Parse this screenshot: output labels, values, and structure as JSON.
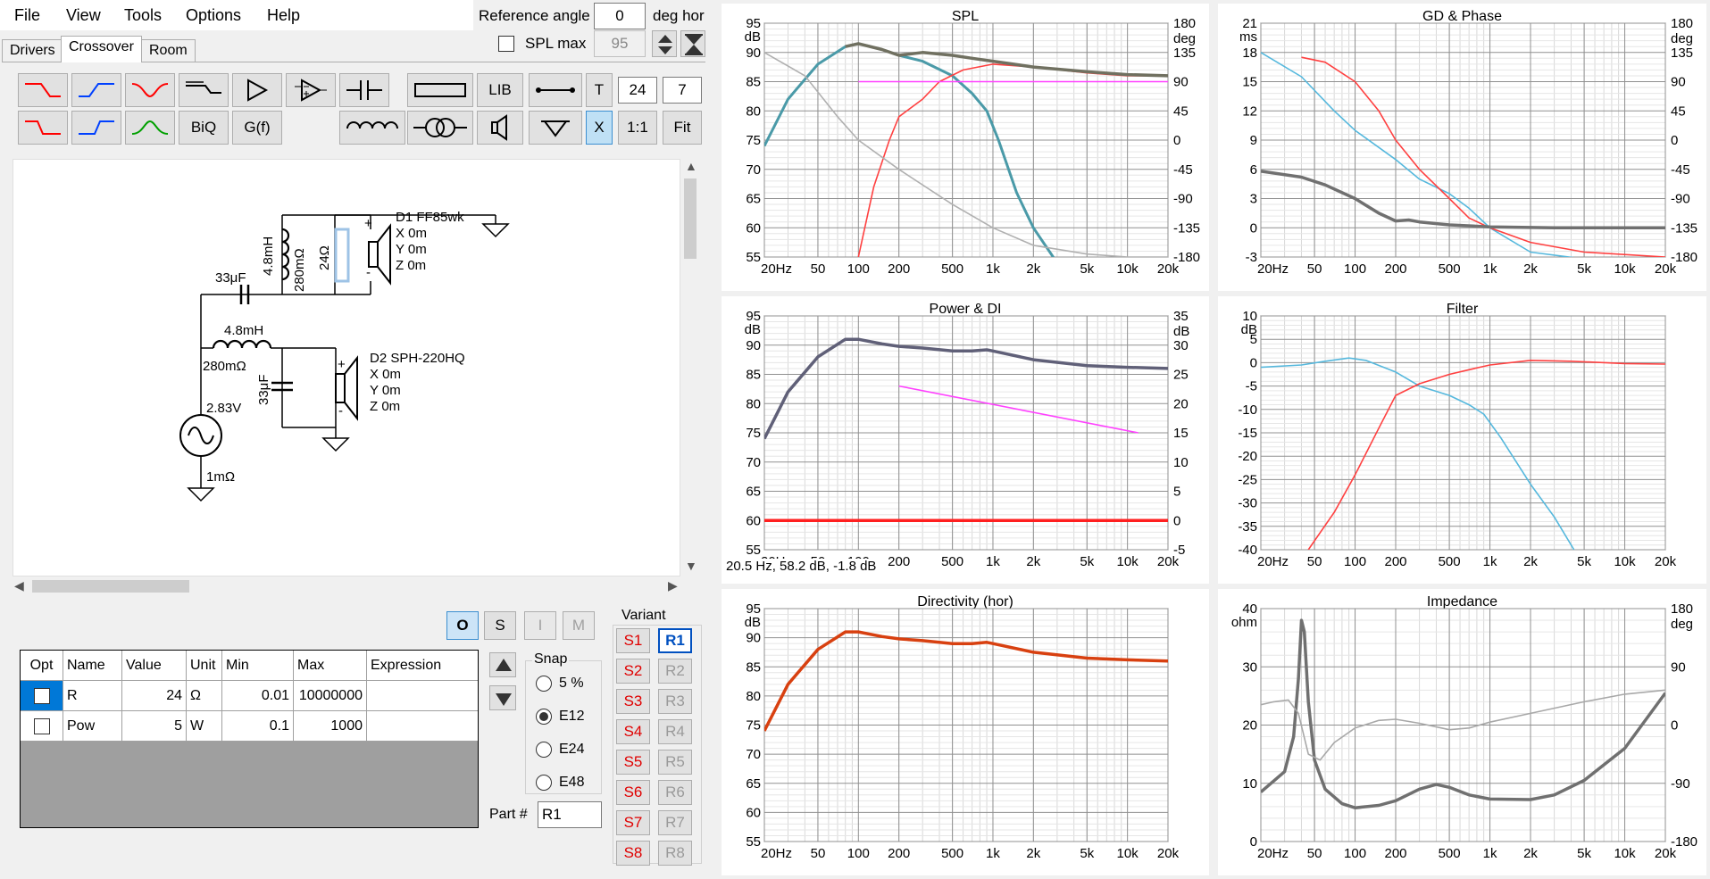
{
  "menu": {
    "file": "File",
    "view": "View",
    "tools": "Tools",
    "options": "Options",
    "help": "Help"
  },
  "header": {
    "reference_angle_label": "Reference angle",
    "reference_angle_value": "0",
    "deg_hor": "deg hor",
    "spl_max_label": "SPL max",
    "spl_max_value": "95"
  },
  "tabs": {
    "drivers": "Drivers",
    "crossover": "Crossover",
    "room": "Room"
  },
  "toolbar": {
    "lib": "LIB",
    "t": "T",
    "order": "24",
    "slope": "7",
    "biq": "BiQ",
    "gf": "G(f)",
    "x": "X",
    "one_to_one": "1:1",
    "fit": "Fit"
  },
  "colors": {
    "accent_red": "#ff0000",
    "accent_blue": "#0040ff",
    "accent_green": "#00a000",
    "selected_button": "#bfe0f5"
  },
  "schematic": {
    "d1_name": "D1 FF85wk",
    "d1_x": "X 0m",
    "d1_y": "Y 0m",
    "d1_z": "Z 0m",
    "d2_name": "D2 SPH-220HQ",
    "d2_x": "X 0m",
    "d2_y": "Y 0m",
    "d2_z": "Z 0m",
    "l1_value": "4.8mH",
    "l1_res": "280mΩ",
    "r1_value": "24Ω",
    "c1_value": "33μF",
    "l2_value": "4.8mH",
    "l2_res": "280mΩ",
    "c2_value": "33μF",
    "source_voltage": "2.83V",
    "source_res": "1mΩ",
    "plus": "+",
    "minus": "-"
  },
  "buttons": {
    "o": "O",
    "s": "S",
    "i": "I",
    "m": "M"
  },
  "table": {
    "headers": [
      "Opt",
      "Name",
      "Value",
      "Unit",
      "Min",
      "Max",
      "Expression"
    ],
    "rows": [
      [
        "",
        "R",
        "24",
        "Ω",
        "0.01",
        "10000000",
        ""
      ],
      [
        "",
        "Pow",
        "5",
        "W",
        "0.1",
        "1000",
        ""
      ]
    ]
  },
  "snap": {
    "label": "Snap",
    "options": [
      "5 %",
      "E12",
      "E24",
      "E48"
    ],
    "selected": "E12"
  },
  "part": {
    "label": "Part #",
    "value": "R1"
  },
  "variant": {
    "label": "Variant",
    "s": [
      "S1",
      "S2",
      "S3",
      "S4",
      "S5",
      "S6",
      "S7",
      "S8"
    ],
    "r": [
      "R1",
      "R2",
      "R3",
      "R4",
      "R5",
      "R6",
      "R7",
      "R8"
    ]
  },
  "charts": {
    "spl": {
      "title": "SPL",
      "yunit": "dB",
      "yunit2": "deg",
      "y_ticks": [
        "95",
        "90",
        "85",
        "80",
        "75",
        "70",
        "65",
        "60",
        "55"
      ],
      "y2_ticks": [
        "180",
        "135",
        "90",
        "45",
        "0",
        "-45",
        "-90",
        "-135",
        "-180"
      ]
    },
    "gd": {
      "title": "GD & Phase",
      "yunit": "ms",
      "yunit2": "deg",
      "y_ticks": [
        "21",
        "18",
        "15",
        "12",
        "9",
        "6",
        "3",
        "0",
        "-3"
      ],
      "y2_ticks": [
        "180",
        "135",
        "90",
        "45",
        "0",
        "-45",
        "-90",
        "-135",
        "-180"
      ]
    },
    "power": {
      "title": "Power & DI",
      "yunit": "dB",
      "yunit2": "dB",
      "y_ticks": [
        "95",
        "90",
        "85",
        "80",
        "75",
        "70",
        "65",
        "60",
        "55"
      ],
      "y2_ticks": [
        "35",
        "30",
        "25",
        "20",
        "15",
        "10",
        "5",
        "0",
        "-5"
      ],
      "readout": "20.5 Hz, 58.2 dB, -1.8 dB"
    },
    "filter": {
      "title": "Filter",
      "yunit": "dB",
      "y_ticks": [
        "10",
        "5",
        "0",
        "-5",
        "-10",
        "-15",
        "-20",
        "-25",
        "-30",
        "-35",
        "-40"
      ]
    },
    "dir": {
      "title": "Directivity (hor)",
      "yunit": "dB",
      "y_ticks": [
        "95",
        "90",
        "85",
        "80",
        "75",
        "70",
        "65",
        "60",
        "55"
      ]
    },
    "imp": {
      "title": "Impedance",
      "yunit": "ohm",
      "yunit2": "deg",
      "y_ticks": [
        "40",
        "30",
        "20",
        "10",
        "0"
      ],
      "y2_ticks": [
        "180",
        "90",
        "0",
        "-90",
        "-180"
      ]
    },
    "x_ticks": [
      "20Hz",
      "50",
      "100",
      "200",
      "500",
      "1k",
      "2k",
      "5k",
      "10k",
      "20k"
    ]
  },
  "chart_data": [
    {
      "type": "line",
      "title": "SPL",
      "x_scale": "log",
      "xlim": [
        20,
        20000
      ],
      "ylim": [
        55,
        95
      ],
      "y2lim": [
        -180,
        180
      ],
      "series": [
        {
          "color": "#4a9aa8",
          "points": [
            [
              20,
              74
            ],
            [
              30,
              82
            ],
            [
              50,
              88
            ],
            [
              80,
              91
            ],
            [
              100,
              91.5
            ],
            [
              150,
              90.5
            ],
            [
              200,
              89.5
            ],
            [
              300,
              88.5
            ],
            [
              500,
              86
            ],
            [
              700,
              83
            ],
            [
              900,
              80
            ],
            [
              1100,
              75
            ],
            [
              1500,
              66
            ],
            [
              2000,
              60
            ],
            [
              3000,
              54
            ]
          ]
        },
        {
          "color": "#ff4040",
          "points": [
            [
              100,
              55
            ],
            [
              130,
              67
            ],
            [
              170,
              75
            ],
            [
              200,
              79
            ],
            [
              300,
              82
            ],
            [
              400,
              85
            ],
            [
              600,
              87
            ],
            [
              1000,
              88
            ],
            [
              2000,
              87.5
            ],
            [
              5000,
              86.5
            ],
            [
              10000,
              86
            ],
            [
              20000,
              86
            ]
          ]
        },
        {
          "color": "#707060",
          "points": [
            [
              80,
              91
            ],
            [
              100,
              91.5
            ],
            [
              150,
              90.5
            ],
            [
              200,
              89.5
            ],
            [
              300,
              90
            ],
            [
              500,
              89.5
            ],
            [
              700,
              89
            ],
            [
              1000,
              88.5
            ],
            [
              2000,
              87.5
            ],
            [
              5000,
              86.7
            ],
            [
              10000,
              86.2
            ],
            [
              20000,
              86
            ]
          ]
        },
        {
          "color": "#ff40ff",
          "points": [
            [
              100,
              85
            ],
            [
              1000,
              85
            ],
            [
              20000,
              85
            ]
          ]
        },
        {
          "color": "#b0b0b0",
          "points": [
            [
              20,
              90
            ],
            [
              40,
              86
            ],
            [
              70,
              79
            ],
            [
              100,
              75
            ],
            [
              200,
              70
            ],
            [
              500,
              64
            ],
            [
              1000,
              60
            ],
            [
              2000,
              57
            ],
            [
              5000,
              55.5
            ],
            [
              10000,
              55
            ],
            [
              20000,
              55
            ]
          ]
        }
      ]
    },
    {
      "type": "line",
      "title": "GD & Phase",
      "x_scale": "log",
      "xlim": [
        20,
        20000
      ],
      "ylim": [
        -3,
        21
      ],
      "series": [
        {
          "color": "#55b8dd",
          "points": [
            [
              20,
              18
            ],
            [
              40,
              15.5
            ],
            [
              70,
              12
            ],
            [
              100,
              10
            ],
            [
              200,
              7
            ],
            [
              300,
              5
            ],
            [
              500,
              3.5
            ],
            [
              700,
              2
            ],
            [
              1000,
              0
            ],
            [
              2000,
              -2.5
            ],
            [
              5000,
              -3.2
            ],
            [
              20000,
              -3.2
            ]
          ]
        },
        {
          "color": "#ff4040",
          "points": [
            [
              40,
              17.5
            ],
            [
              60,
              17
            ],
            [
              100,
              15
            ],
            [
              150,
              12
            ],
            [
              200,
              9
            ],
            [
              300,
              6
            ],
            [
              500,
              3
            ],
            [
              700,
              1
            ],
            [
              1000,
              0
            ],
            [
              2000,
              -1.5
            ],
            [
              5000,
              -2.5
            ],
            [
              20000,
              -3
            ]
          ]
        },
        {
          "color": "#707070",
          "points": [
            [
              20,
              5.8
            ],
            [
              40,
              5.2
            ],
            [
              60,
              4.4
            ],
            [
              100,
              3
            ],
            [
              150,
              1.5
            ],
            [
              200,
              0.7
            ],
            [
              250,
              0.8
            ],
            [
              300,
              0.6
            ],
            [
              500,
              0.3
            ],
            [
              1000,
              0.1
            ],
            [
              3000,
              0
            ],
            [
              20000,
              0
            ]
          ]
        }
      ]
    },
    {
      "type": "line",
      "title": "Power & DI",
      "x_scale": "log",
      "xlim": [
        20,
        20000
      ],
      "ylim": [
        55,
        95
      ],
      "y2lim": [
        -5,
        35
      ],
      "series": [
        {
          "color": "#606078",
          "points": [
            [
              20,
              74
            ],
            [
              30,
              82
            ],
            [
              50,
              88
            ],
            [
              80,
              91
            ],
            [
              100,
              91
            ],
            [
              150,
              90.2
            ],
            [
              200,
              89.8
            ],
            [
              300,
              89.5
            ],
            [
              500,
              89
            ],
            [
              700,
              89
            ],
            [
              900,
              89.2
            ],
            [
              1000,
              89
            ],
            [
              2000,
              87.5
            ],
            [
              5000,
              86.5
            ],
            [
              10000,
              86.2
            ],
            [
              20000,
              86
            ]
          ]
        },
        {
          "color": "#ff40ff",
          "points": [
            [
              200,
              83
            ],
            [
              12000,
              75
            ]
          ]
        },
        {
          "color": "#ff2020",
          "points": [
            [
              20,
              60
            ],
            [
              20000,
              60
            ]
          ]
        }
      ]
    },
    {
      "type": "line",
      "title": "Filter",
      "x_scale": "log",
      "xlim": [
        20,
        20000
      ],
      "ylim": [
        -40,
        10
      ],
      "series": [
        {
          "color": "#55b8dd",
          "points": [
            [
              20,
              -1
            ],
            [
              40,
              -0.5
            ],
            [
              60,
              0.3
            ],
            [
              90,
              1
            ],
            [
              120,
              0.5
            ],
            [
              200,
              -2
            ],
            [
              300,
              -5
            ],
            [
              500,
              -7
            ],
            [
              700,
              -9
            ],
            [
              900,
              -11
            ],
            [
              1200,
              -16
            ],
            [
              2000,
              -26
            ],
            [
              3000,
              -33
            ],
            [
              4200,
              -40
            ]
          ]
        },
        {
          "color": "#ff4040",
          "points": [
            [
              45,
              -40
            ],
            [
              70,
              -32
            ],
            [
              100,
              -24
            ],
            [
              150,
              -14
            ],
            [
              200,
              -7
            ],
            [
              300,
              -4.5
            ],
            [
              500,
              -2.5
            ],
            [
              700,
              -1.5
            ],
            [
              1000,
              -0.5
            ],
            [
              2000,
              0.5
            ],
            [
              4000,
              0.3
            ],
            [
              10000,
              -0.2
            ],
            [
              20000,
              -0.3
            ]
          ]
        }
      ]
    },
    {
      "type": "line",
      "title": "Directivity (hor)",
      "x_scale": "log",
      "xlim": [
        20,
        20000
      ],
      "ylim": [
        55,
        95
      ],
      "series": [
        {
          "color": "#d84010",
          "points": [
            [
              20,
              74
            ],
            [
              30,
              82
            ],
            [
              50,
              88
            ],
            [
              80,
              91
            ],
            [
              100,
              91
            ],
            [
              150,
              90.2
            ],
            [
              200,
              89.8
            ],
            [
              300,
              89.5
            ],
            [
              500,
              89
            ],
            [
              700,
              89
            ],
            [
              900,
              89.2
            ],
            [
              1000,
              89
            ],
            [
              2000,
              87.5
            ],
            [
              5000,
              86.5
            ],
            [
              10000,
              86.2
            ],
            [
              20000,
              86
            ]
          ]
        }
      ]
    },
    {
      "type": "line",
      "title": "Impedance",
      "x_scale": "log",
      "xlim": [
        20,
        20000
      ],
      "ylim": [
        0,
        40
      ],
      "y2lim": [
        -180,
        180
      ],
      "series": [
        {
          "color": "#707070",
          "points": [
            [
              20,
              8.5
            ],
            [
              30,
              12
            ],
            [
              35,
              18
            ],
            [
              38,
              28
            ],
            [
              40,
              38
            ],
            [
              42,
              36
            ],
            [
              45,
              24
            ],
            [
              50,
              14
            ],
            [
              60,
              9
            ],
            [
              80,
              6.5
            ],
            [
              100,
              5.8
            ],
            [
              150,
              6.2
            ],
            [
              200,
              7
            ],
            [
              300,
              9
            ],
            [
              400,
              9.8
            ],
            [
              500,
              9.3
            ],
            [
              700,
              8
            ],
            [
              1000,
              7.3
            ],
            [
              2000,
              7.2
            ],
            [
              3000,
              8
            ],
            [
              5000,
              10.5
            ],
            [
              10000,
              16
            ],
            [
              20000,
              25.5
            ]
          ]
        },
        {
          "color": "#a8a8a8",
          "points": [
            [
              20,
              23.5
            ],
            [
              25,
              24
            ],
            [
              32,
              24.3
            ],
            [
              38,
              22
            ],
            [
              45,
              15
            ],
            [
              55,
              14
            ],
            [
              70,
              17
            ],
            [
              100,
              19.5
            ],
            [
              150,
              20.8
            ],
            [
              200,
              21
            ],
            [
              300,
              20.3
            ],
            [
              500,
              19.2
            ],
            [
              700,
              19.5
            ],
            [
              1000,
              20.5
            ],
            [
              2000,
              22
            ],
            [
              5000,
              24
            ],
            [
              10000,
              25.3
            ],
            [
              20000,
              26
            ]
          ]
        }
      ]
    }
  ]
}
